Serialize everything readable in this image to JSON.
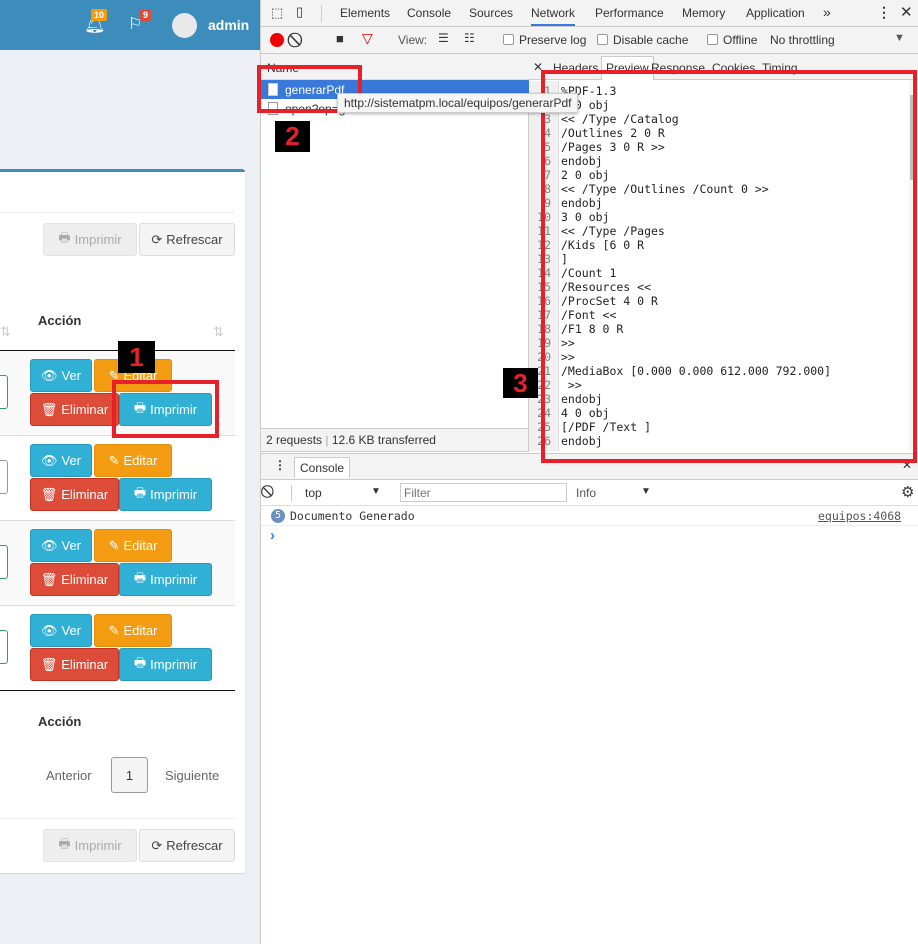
{
  "app": {
    "header": {
      "notifications_count": "10",
      "flags_count": "9",
      "user": "admin",
      "colors": {
        "bar": "#3c8dbc",
        "notif_badge": "#f39c12",
        "flag_badge": "#dd4b39"
      }
    },
    "toolbar": {
      "print_label": "Imprimir",
      "refresh_label": "Refrescar"
    },
    "table": {
      "action_header": "Acción",
      "rows": [
        {
          "view": "Ver",
          "edit": "Editar",
          "delete": "Eliminar",
          "print": "Imprimir"
        },
        {
          "view": "Ver",
          "edit": "Editar",
          "delete": "Eliminar",
          "print": "Imprimir"
        },
        {
          "view": "Ver",
          "edit": "Editar",
          "delete": "Eliminar",
          "print": "Imprimir"
        },
        {
          "view": "Ver",
          "edit": "Editar",
          "delete": "Eliminar",
          "print": "Imprimir"
        }
      ],
      "footer_action_header": "Acción"
    },
    "pagination": {
      "prev": "Anterior",
      "page": "1",
      "next": "Siguiente"
    }
  },
  "devtools": {
    "tabs": [
      "Elements",
      "Console",
      "Sources",
      "Network",
      "Performance",
      "Memory",
      "Application"
    ],
    "active_tab": "Network",
    "more": "»",
    "network_toolbar": {
      "view_label": "View:",
      "preserve_log": "Preserve log",
      "disable_cache": "Disable cache",
      "offline": "Offline",
      "throttling": "No throttling"
    },
    "requests": {
      "name_header": "Name",
      "items": [
        "generarPdf",
        "open?op=getData-b0ab3b1d8e52e701a"
      ],
      "tooltip": "http://sistematpm.local/equipos/generarPdf",
      "status": "2 requests",
      "transferred": "12.6 KB transferred"
    },
    "detail_tabs": [
      "Headers",
      "Preview",
      "Response",
      "Cookies",
      "Timing"
    ],
    "active_detail_tab": "Preview",
    "preview_lines": [
      "%PDF-1.3",
      "1 0 obj",
      "<< /Type /Catalog",
      "/Outlines 2 0 R",
      "/Pages 3 0 R >>",
      "endobj",
      "2 0 obj",
      "<< /Type /Outlines /Count 0 >>",
      "endobj",
      "3 0 obj",
      "<< /Type /Pages",
      "/Kids [6 0 R",
      "]",
      "/Count 1",
      "/Resources <<",
      "/ProcSet 4 0 R",
      "/Font <<",
      "/F1 8 0 R",
      ">>",
      ">>",
      "/MediaBox [0.000 0.000 612.000 792.000]",
      " >>",
      "endobj",
      "4 0 obj",
      "[/PDF /Text ]",
      "endobj"
    ],
    "console": {
      "tab": "Console",
      "context": "top",
      "filter_placeholder": "Filter",
      "level": "Info",
      "messages": [
        {
          "count": "5",
          "text": "Documento Generado",
          "source": "equipos:4068"
        }
      ],
      "prompt": "›"
    }
  },
  "annotations": {
    "labels": [
      "1",
      "2",
      "3"
    ],
    "color": "#e8202a"
  }
}
